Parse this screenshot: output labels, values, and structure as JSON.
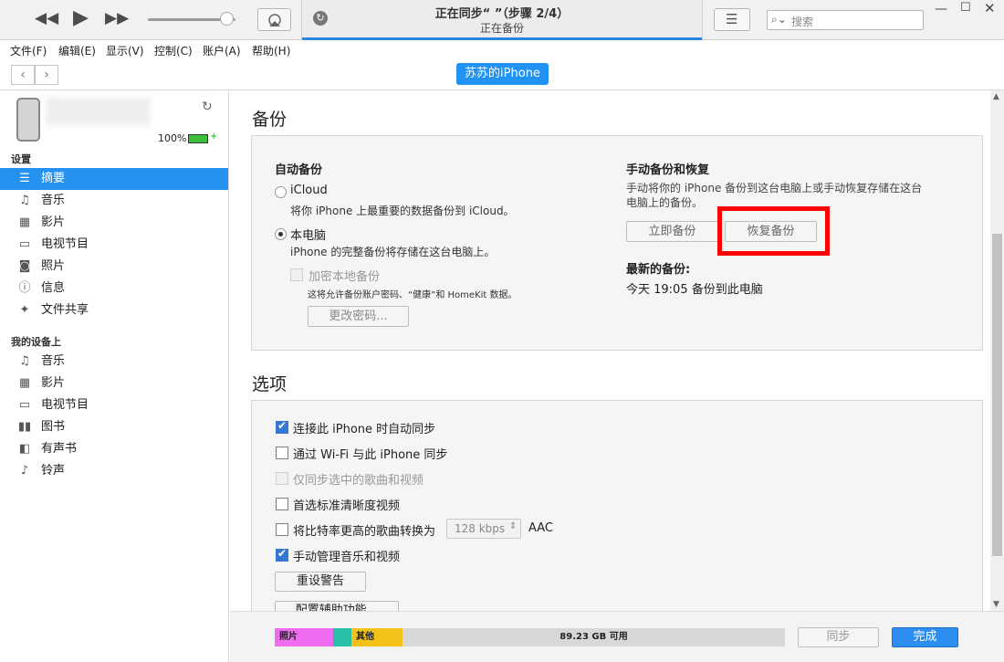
{
  "titlebar": {
    "status_title": "正在同步“          ”（步骤 2/4）",
    "status_subtitle": "正在备份",
    "search_placeholder": "搜索",
    "volume_level": 0.9
  },
  "menu": [
    "文件(F)",
    "编辑(E)",
    "显示(V)",
    "控制(C)",
    "账户(A)",
    "帮助(H)"
  ],
  "nav": {
    "device_button": "苏苏的iPhone"
  },
  "sidebar": {
    "battery": "100%",
    "settings_header": "设置",
    "settings_items": [
      {
        "label": "摘要",
        "icon": "summary-icon",
        "selected": true
      },
      {
        "label": "音乐",
        "icon": "music-icon"
      },
      {
        "label": "影片",
        "icon": "film-icon"
      },
      {
        "label": "电视节目",
        "icon": "tv-icon"
      },
      {
        "label": "照片",
        "icon": "camera-icon"
      },
      {
        "label": "信息",
        "icon": "info-icon"
      },
      {
        "label": "文件共享",
        "icon": "apps-icon"
      }
    ],
    "device_header": "我的设备上",
    "device_items": [
      {
        "label": "音乐",
        "icon": "music-icon"
      },
      {
        "label": "影片",
        "icon": "film-icon"
      },
      {
        "label": "电视节目",
        "icon": "tv-icon"
      },
      {
        "label": "图书",
        "icon": "book-icon"
      },
      {
        "label": "有声书",
        "icon": "audiobook-icon"
      },
      {
        "label": "铃声",
        "icon": "bell-icon"
      }
    ]
  },
  "backup": {
    "title": "备份",
    "auto_title": "自动备份",
    "icloud_label": "iCloud",
    "icloud_desc": "将你 iPhone 上最重要的数据备份到 iCloud。",
    "local_label": "本电脑",
    "local_desc": "iPhone 的完整备份将存储在这台电脑上。",
    "encrypt_label": "加密本地备份",
    "encrypt_desc": "这将允许备份账户密码、“健康”和 HomeKit 数据。",
    "change_password": "更改密码...",
    "manual_title": "手动备份和恢复",
    "manual_desc_1": "手动将你的 iPhone 备份到这台电脑上或手动恢复存储在这台",
    "manual_desc_2": "电脑上的备份。",
    "backup_now": "立即备份",
    "restore_backup": "恢复备份",
    "latest_title": "最新的备份:",
    "latest_value": "今天 19:05 备份到此电脑"
  },
  "options": {
    "title": "选项",
    "items": [
      {
        "label": "连接此 iPhone 时自动同步",
        "checked": true
      },
      {
        "label": "通过 Wi-Fi 与此 iPhone 同步",
        "checked": false
      },
      {
        "label": "仅同步选中的歌曲和视频",
        "checked": false,
        "disabled": true
      },
      {
        "label": "首选标准清晰度视频",
        "checked": false
      },
      {
        "label": "将比特率更高的歌曲转换为",
        "checked": false
      },
      {
        "label": "手动管理音乐和视频",
        "checked": true
      }
    ],
    "bitrate_value": "128 kbps",
    "bitrate_unit": "AAC",
    "reset_warnings": "重设警告",
    "accessibility": "配置辅助功能..."
  },
  "storage": {
    "photos_label": "照片",
    "other_label": "其他",
    "free_label": "89.23 GB 可用",
    "colors": {
      "photos": "#ef6cf0",
      "apps": "#25c0a5",
      "other": "#f4c319",
      "free": "#d8d8d8"
    }
  },
  "footer": {
    "sync_label": "同步",
    "done_label": "完成"
  }
}
